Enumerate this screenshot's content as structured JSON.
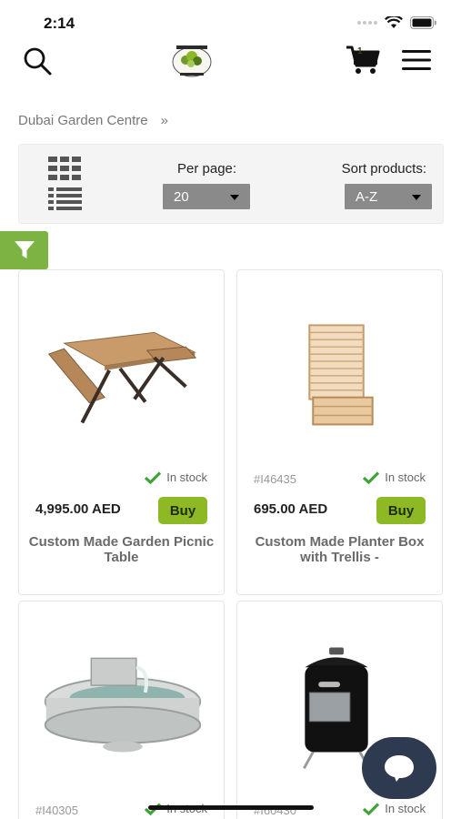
{
  "status_bar": {
    "time": "2:14"
  },
  "header": {
    "cart_count": "1",
    "logo_text": "DUBAI GARDEN CENTRE"
  },
  "breadcrumb": {
    "items": [
      "Dubai Garden Centre",
      "»"
    ]
  },
  "toolbar": {
    "per_page_label": "Per page:",
    "per_page_value": "20",
    "sort_label": "Sort products:",
    "sort_value": "A-Z"
  },
  "products": [
    {
      "sku": "",
      "stock": "In stock",
      "price": "4,995.00 AED",
      "buy_label": "Buy",
      "name": "Custom Made Garden Picnic Table",
      "image": "picnic-table"
    },
    {
      "sku": "#I46435",
      "stock": "In stock",
      "price": "695.00 AED",
      "buy_label": "Buy",
      "name": "Custom Made Planter Box with Trellis -",
      "image": "planter-box-trellis"
    },
    {
      "sku": "#I40305",
      "stock": "In stock",
      "price": "",
      "buy_label": "",
      "name": "",
      "image": "fountain"
    },
    {
      "sku": "#I60430",
      "stock": "In stock",
      "price": "",
      "buy_label": "",
      "name": "",
      "image": "smoker-grill"
    }
  ],
  "colors": {
    "accent_green": "#8db924",
    "filter_green": "#7cb342",
    "check_green": "#3fa33a",
    "chat_fab": "#2e3a4f"
  }
}
